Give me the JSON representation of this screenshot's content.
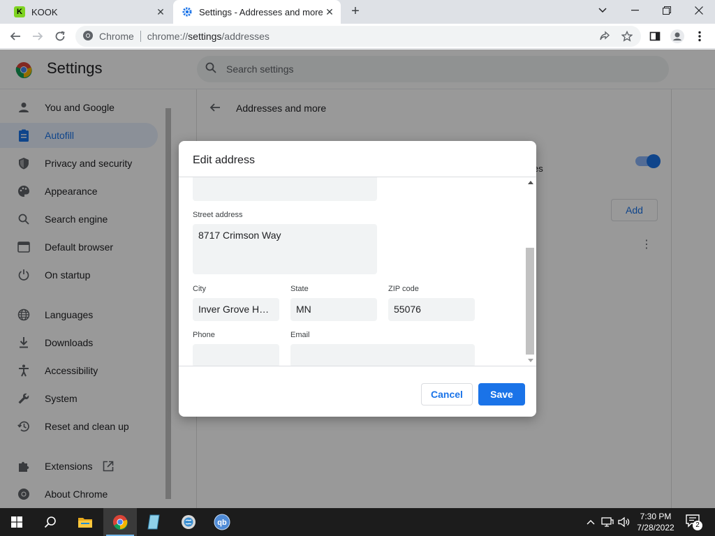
{
  "browser": {
    "tabs": [
      {
        "title": "KOOK",
        "favicon": "kook-logo-icon",
        "active": false
      },
      {
        "title": "Settings - Addresses and more",
        "favicon": "settings-gear-icon",
        "active": true
      }
    ],
    "new_tab_label": "+",
    "omnibox": {
      "scheme_label": "Chrome",
      "url_prefix": "chrome://",
      "url_host": "settings",
      "url_path": "/addresses"
    }
  },
  "settings": {
    "title": "Settings",
    "search_placeholder": "Search settings",
    "nav": [
      {
        "label": "You and Google",
        "icon": "person-icon"
      },
      {
        "label": "Autofill",
        "icon": "clipboard-icon",
        "active": true
      },
      {
        "label": "Privacy and security",
        "icon": "shield-icon"
      },
      {
        "label": "Appearance",
        "icon": "palette-icon"
      },
      {
        "label": "Search engine",
        "icon": "search-icon"
      },
      {
        "label": "Default browser",
        "icon": "browser-icon"
      },
      {
        "label": "On startup",
        "icon": "power-icon"
      },
      {
        "label": "Languages",
        "icon": "globe-icon"
      },
      {
        "label": "Downloads",
        "icon": "download-icon"
      },
      {
        "label": "Accessibility",
        "icon": "accessibility-icon"
      },
      {
        "label": "System",
        "icon": "wrench-icon"
      },
      {
        "label": "Reset and clean up",
        "icon": "history-icon"
      },
      {
        "label": "Extensions",
        "icon": "puzzle-icon"
      },
      {
        "label": "About Chrome",
        "icon": "chrome-icon"
      }
    ],
    "page_title": "Addresses and more",
    "partial_text": "es",
    "add_label": "Add",
    "toggle_on": true
  },
  "dialog": {
    "title": "Edit address",
    "fields": {
      "street_label": "Street address",
      "street_value": "8717 Crimson Way",
      "city_label": "City",
      "city_value": "Inver Grove Heig...",
      "state_label": "State",
      "state_value": "MN",
      "zip_label": "ZIP code",
      "zip_value": "55076",
      "phone_label": "Phone",
      "phone_value": "",
      "email_label": "Email",
      "email_value": ""
    },
    "cancel_label": "Cancel",
    "save_label": "Save"
  },
  "taskbar": {
    "apps": [
      "windows-start-icon",
      "search-icon",
      "file-explorer-icon",
      "chrome-icon",
      "notepad-icon",
      "globe-app-icon",
      "qbittorrent-icon"
    ],
    "qb_label": "qb",
    "time": "7:30 PM",
    "date": "7/28/2022",
    "notification_count": "2"
  },
  "colors": {
    "accent": "#1a73e8",
    "active_nav_bg": "#e8f0fe",
    "taskbar": "#1c1c1c"
  }
}
